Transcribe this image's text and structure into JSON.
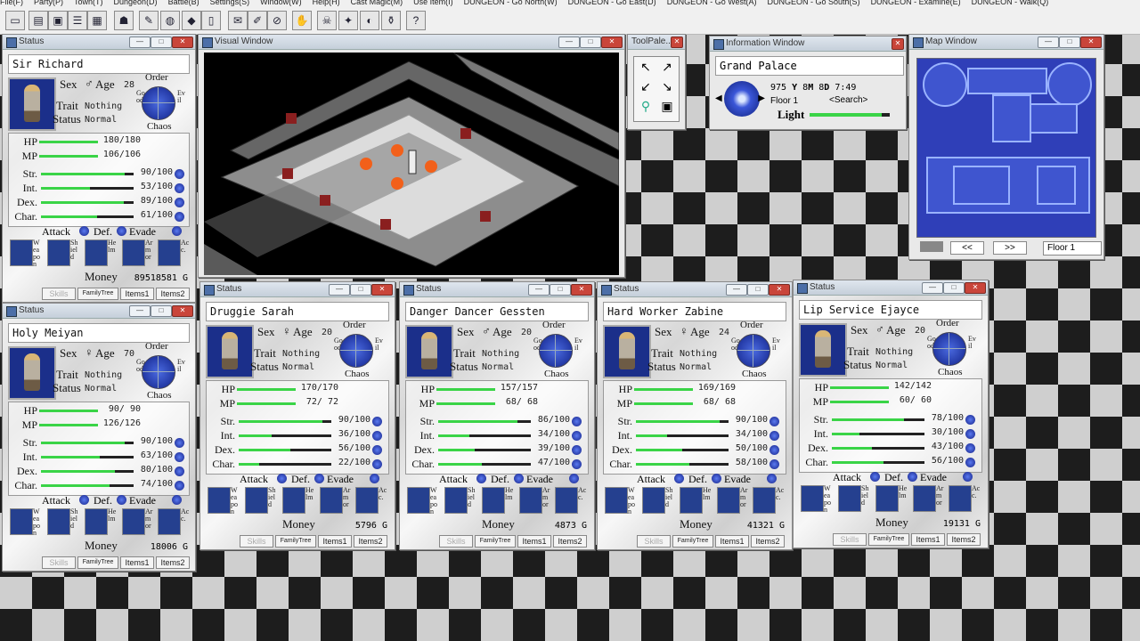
{
  "menubar": [
    "File(F)",
    "Party(P)",
    "Town(T)",
    "Dungeon(D)",
    "Battle(B)",
    "Settings(S)",
    "Window(W)",
    "Help(H)",
    "Cast Magic(M)",
    "Use Item(I)",
    "DUNGEON - Go North(W)",
    "DUNGEON - Go East(D)",
    "DUNGEON - Go West(A)",
    "DUNGEON - Go South(S)",
    "DUNGEON - Examine(E)",
    "DUNGEON - Walk(Q)"
  ],
  "windows": {
    "status": "Status",
    "visual": "Visual Window",
    "toolpalette": "ToolPale...",
    "info": "Information Window",
    "map": "Map Window"
  },
  "labels": {
    "sex": "Sex",
    "age": "Age",
    "trait": "Trait",
    "status": "Status",
    "order": "Order",
    "good": "Good",
    "evil": "Evil",
    "chaos": "Chaos",
    "hp": "HP",
    "mp": "MP",
    "str": "Str.",
    "int": "Int.",
    "dex": "Dex.",
    "char": "Char.",
    "attack": "Attack",
    "def": "Def.",
    "evade": "Evade",
    "weapon": "Weapon",
    "shield": "Shield",
    "helm": "Helm",
    "armor": "Armor",
    "acc": "Acc.",
    "money": "Money",
    "skills": "Skills",
    "family": "FamilyTree",
    "items1": "Items1",
    "items2": "Items2"
  },
  "info": {
    "location": "Grand Palace",
    "year": "975",
    "y": "Y",
    "month": "8",
    "m": "M",
    "day": "8",
    "d": "D",
    "time": "7:49",
    "floor": "Floor 1",
    "search": "<Search>",
    "light": "Light",
    "light_level": 0.9
  },
  "map": {
    "prev": "<<",
    "next": ">>",
    "floor": "Floor 1"
  },
  "characters": [
    {
      "name": "Sir Richard",
      "sex": "♂",
      "age": "28",
      "trait": "Nothing",
      "status": "Normal",
      "hp": "180/180",
      "hp_pct": 1.0,
      "mp": "106/106",
      "mp_pct": 1.0,
      "str": "90/100",
      "str_pct": 0.9,
      "int": "53/100",
      "int_pct": 0.53,
      "dex": "89/100",
      "dex_pct": 0.89,
      "char": "61/100",
      "char_pct": 0.61,
      "money": "89518581 G"
    },
    {
      "name": "Holy Meiyan",
      "sex": "♀",
      "age": "70",
      "trait": "Nothing",
      "status": "Normal",
      "hp": "90/ 90",
      "hp_pct": 1.0,
      "mp": "126/126",
      "mp_pct": 1.0,
      "str": "90/100",
      "str_pct": 0.9,
      "int": "63/100",
      "int_pct": 0.63,
      "dex": "80/100",
      "dex_pct": 0.8,
      "char": "74/100",
      "char_pct": 0.74,
      "money": "18006 G"
    },
    {
      "name": "Druggie Sarah",
      "sex": "♀",
      "age": "20",
      "trait": "Nothing",
      "status": "Normal",
      "hp": "170/170",
      "hp_pct": 1.0,
      "mp": "72/ 72",
      "mp_pct": 1.0,
      "str": "90/100",
      "str_pct": 0.9,
      "int": "36/100",
      "int_pct": 0.36,
      "dex": "56/100",
      "dex_pct": 0.56,
      "char": "22/100",
      "char_pct": 0.22,
      "money": "5796 G"
    },
    {
      "name": "Danger Dancer Gessten",
      "sex": "♂",
      "age": "20",
      "trait": "Nothing",
      "status": "Normal",
      "hp": "157/157",
      "hp_pct": 1.0,
      "mp": "68/ 68",
      "mp_pct": 1.0,
      "str": "86/100",
      "str_pct": 0.86,
      "int": "34/100",
      "int_pct": 0.34,
      "dex": "39/100",
      "dex_pct": 0.39,
      "char": "47/100",
      "char_pct": 0.47,
      "money": "4873 G"
    },
    {
      "name": "Hard Worker Zabine",
      "sex": "♀",
      "age": "24",
      "trait": "Nothing",
      "status": "Normal",
      "hp": "169/169",
      "hp_pct": 1.0,
      "mp": "68/ 68",
      "mp_pct": 1.0,
      "str": "90/100",
      "str_pct": 0.9,
      "int": "34/100",
      "int_pct": 0.34,
      "dex": "50/100",
      "dex_pct": 0.5,
      "char": "58/100",
      "char_pct": 0.58,
      "money": "41321 G"
    },
    {
      "name": "Lip Service Ejayce",
      "sex": "♂",
      "age": "20",
      "trait": "Nothing",
      "status": "Normal",
      "hp": "142/142",
      "hp_pct": 1.0,
      "mp": "60/ 60",
      "mp_pct": 1.0,
      "str": "78/100",
      "str_pct": 0.78,
      "int": "30/100",
      "int_pct": 0.3,
      "dex": "43/100",
      "dex_pct": 0.43,
      "char": "56/100",
      "char_pct": 0.56,
      "money": "19131 G"
    }
  ]
}
